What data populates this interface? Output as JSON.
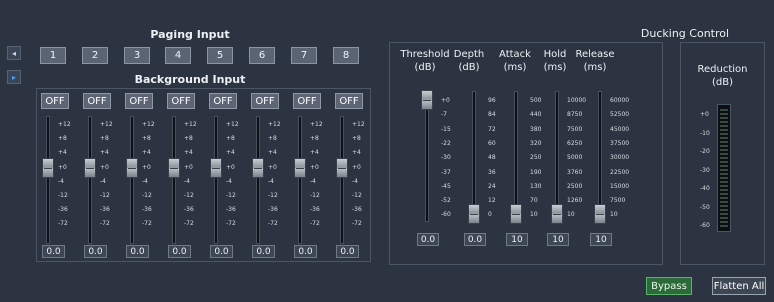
{
  "side_tabs": [
    "◂",
    "▸"
  ],
  "paging": {
    "title": "Paging Input",
    "buttons": [
      "1",
      "2",
      "3",
      "4",
      "5",
      "6",
      "7",
      "8"
    ]
  },
  "background": {
    "title": "Background Input",
    "channels": [
      {
        "off": "OFF",
        "value": "0.0",
        "level": 0.0
      },
      {
        "off": "OFF",
        "value": "0.0",
        "level": 0.0
      },
      {
        "off": "OFF",
        "value": "0.0",
        "level": 0.0
      },
      {
        "off": "OFF",
        "value": "0.0",
        "level": 0.0
      },
      {
        "off": "OFF",
        "value": "0.0",
        "level": 0.0
      },
      {
        "off": "OFF",
        "value": "0.0",
        "level": 0.0
      },
      {
        "off": "OFF",
        "value": "0.0",
        "level": 0.0
      },
      {
        "off": "OFF",
        "value": "0.0",
        "level": 0.0
      }
    ],
    "scale": [
      "+12",
      "+8",
      "+4",
      "+0",
      "-4",
      "-12",
      "-36",
      "-72"
    ]
  },
  "ducking": {
    "title": "Ducking Control",
    "columns": [
      {
        "label": "Threshold",
        "unit": "(dB)",
        "scale": [
          "+0",
          "-7",
          "-15",
          "-22",
          "-30",
          "-37",
          "-45",
          "-52",
          "-60"
        ],
        "value": "0.0"
      },
      {
        "label": "Depth",
        "unit": "(dB)",
        "scale": [
          "96",
          "84",
          "72",
          "60",
          "48",
          "36",
          "24",
          "12",
          "0"
        ],
        "value": "0.0"
      },
      {
        "label": "Attack",
        "unit": "(ms)",
        "scale": [
          "500",
          "440",
          "380",
          "320",
          "250",
          "190",
          "130",
          "70",
          "10"
        ],
        "value": "10"
      },
      {
        "label": "Hold",
        "unit": "(ms)",
        "scale": [
          "10000",
          "8750",
          "7500",
          "6250",
          "5000",
          "3760",
          "2500",
          "1260",
          "10"
        ],
        "value": "10"
      },
      {
        "label": "Release",
        "unit": "(ms)",
        "scale": [
          "60000",
          "52500",
          "45000",
          "37500",
          "30000",
          "22500",
          "15000",
          "7500",
          "10"
        ],
        "value": "10"
      }
    ]
  },
  "reduction": {
    "label": "Reduction",
    "unit": "(dB)",
    "scale": [
      "+0",
      "-10",
      "-20",
      "-30",
      "-40",
      "-50",
      "-60"
    ]
  },
  "buttons": {
    "bypass": "Bypass",
    "flatten": "Flatten All"
  },
  "colors": {
    "bypass_active": "#2c6a3a",
    "panel_bg": "#2b3440"
  }
}
